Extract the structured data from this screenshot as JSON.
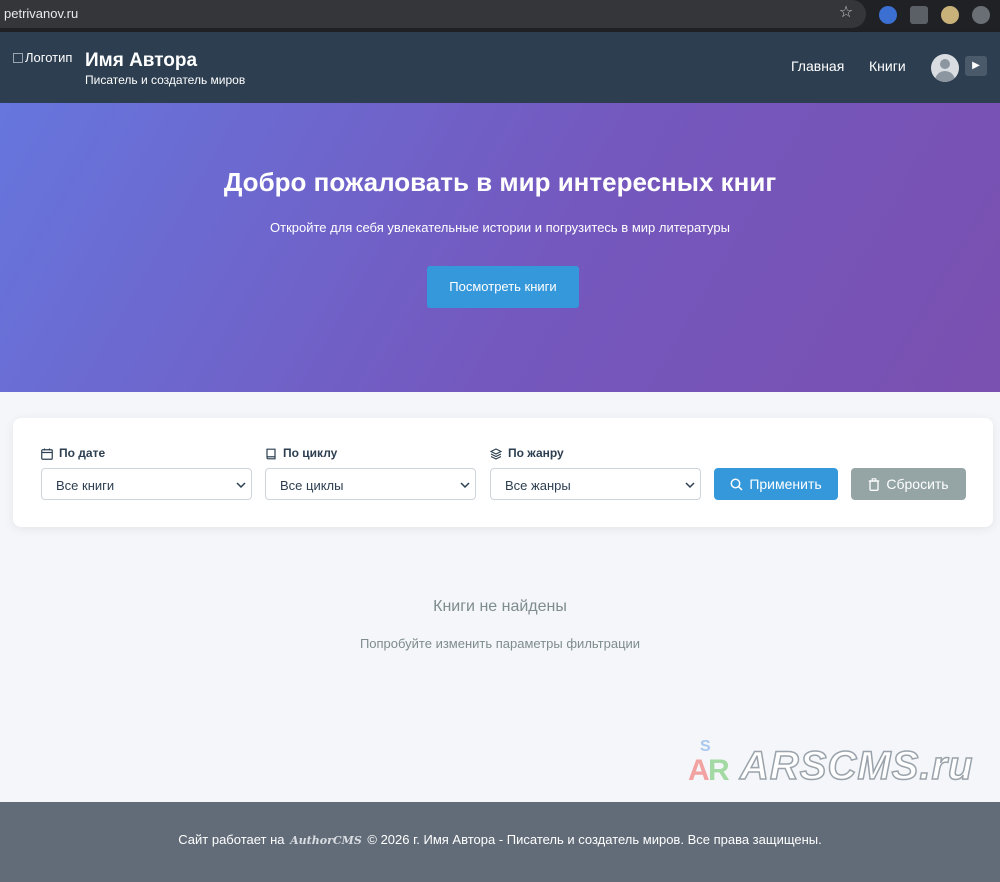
{
  "browser": {
    "url": "petrivanov.ru"
  },
  "header": {
    "logo_alt": "Логотип",
    "author_name": "Имя Автора",
    "tagline": "Писатель и создатель миров",
    "nav": [
      {
        "label": "Главная"
      },
      {
        "label": "Книги"
      }
    ]
  },
  "hero": {
    "title": "Добро пожаловать в мир интересных книг",
    "subtitle": "Откройте для себя увлекательные истории и погрузитесь в мир литературы",
    "cta_label": "Посмотреть книги"
  },
  "filters": {
    "date": {
      "label": "По дате",
      "value": "Все книги",
      "icon": "calendar-icon"
    },
    "cycle": {
      "label": "По циклу",
      "value": "Все циклы",
      "icon": "book-icon"
    },
    "genre": {
      "label": "По жанру",
      "value": "Все жанры",
      "icon": "layers-icon"
    },
    "apply_label": "Применить",
    "reset_label": "Сбросить"
  },
  "empty_state": {
    "title": "Книги не найдены",
    "subtitle": "Попробуйте изменить параметры фильтрации"
  },
  "watermark": {
    "text": "ARSCMS.ru"
  },
  "footer": {
    "prefix": "Сайт работает на",
    "brand": "AuthorCMS",
    "suffix": "© 2026 г. Имя Автора - Писатель и создатель миров. Все права защищены."
  },
  "colors": {
    "header_bg": "#2c3e50",
    "accent": "#3498db",
    "reset_btn": "#95a5a6",
    "footer_bg": "#626c78",
    "hero_start": "#6676dd",
    "hero_end": "#7a50b0"
  }
}
